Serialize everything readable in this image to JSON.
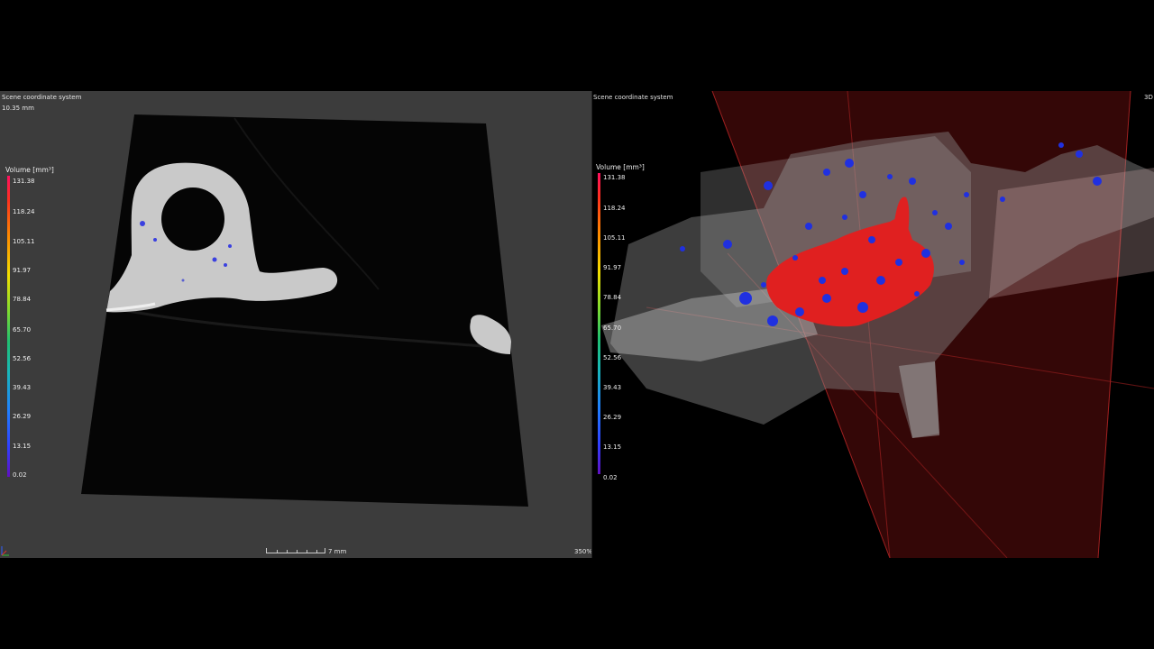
{
  "left_view": {
    "coord_system": "Scene coordinate system",
    "depth": "10.35 mm",
    "scale_bar": "7 mm",
    "zoom": "350%",
    "legend": {
      "title": "Volume [mm³]",
      "ticks": [
        "131.38",
        "118.24",
        "105.11",
        "91.97",
        "78.84",
        "65.70",
        "52.56",
        "39.43",
        "26.29",
        "13.15",
        "0.02"
      ]
    }
  },
  "right_view": {
    "coord_system": "Scene coordinate system",
    "mode": "3D",
    "legend": {
      "title": "Volume [mm³]",
      "ticks": [
        "131.38",
        "118.24",
        "105.11",
        "91.97",
        "78.84",
        "65.70",
        "52.56",
        "39.43",
        "26.29",
        "13.15",
        "0.02"
      ]
    }
  },
  "colors": {
    "defect_high": "#e02020",
    "defect_low": "#2030e0",
    "viewport_bg": "#3c3c3c"
  }
}
